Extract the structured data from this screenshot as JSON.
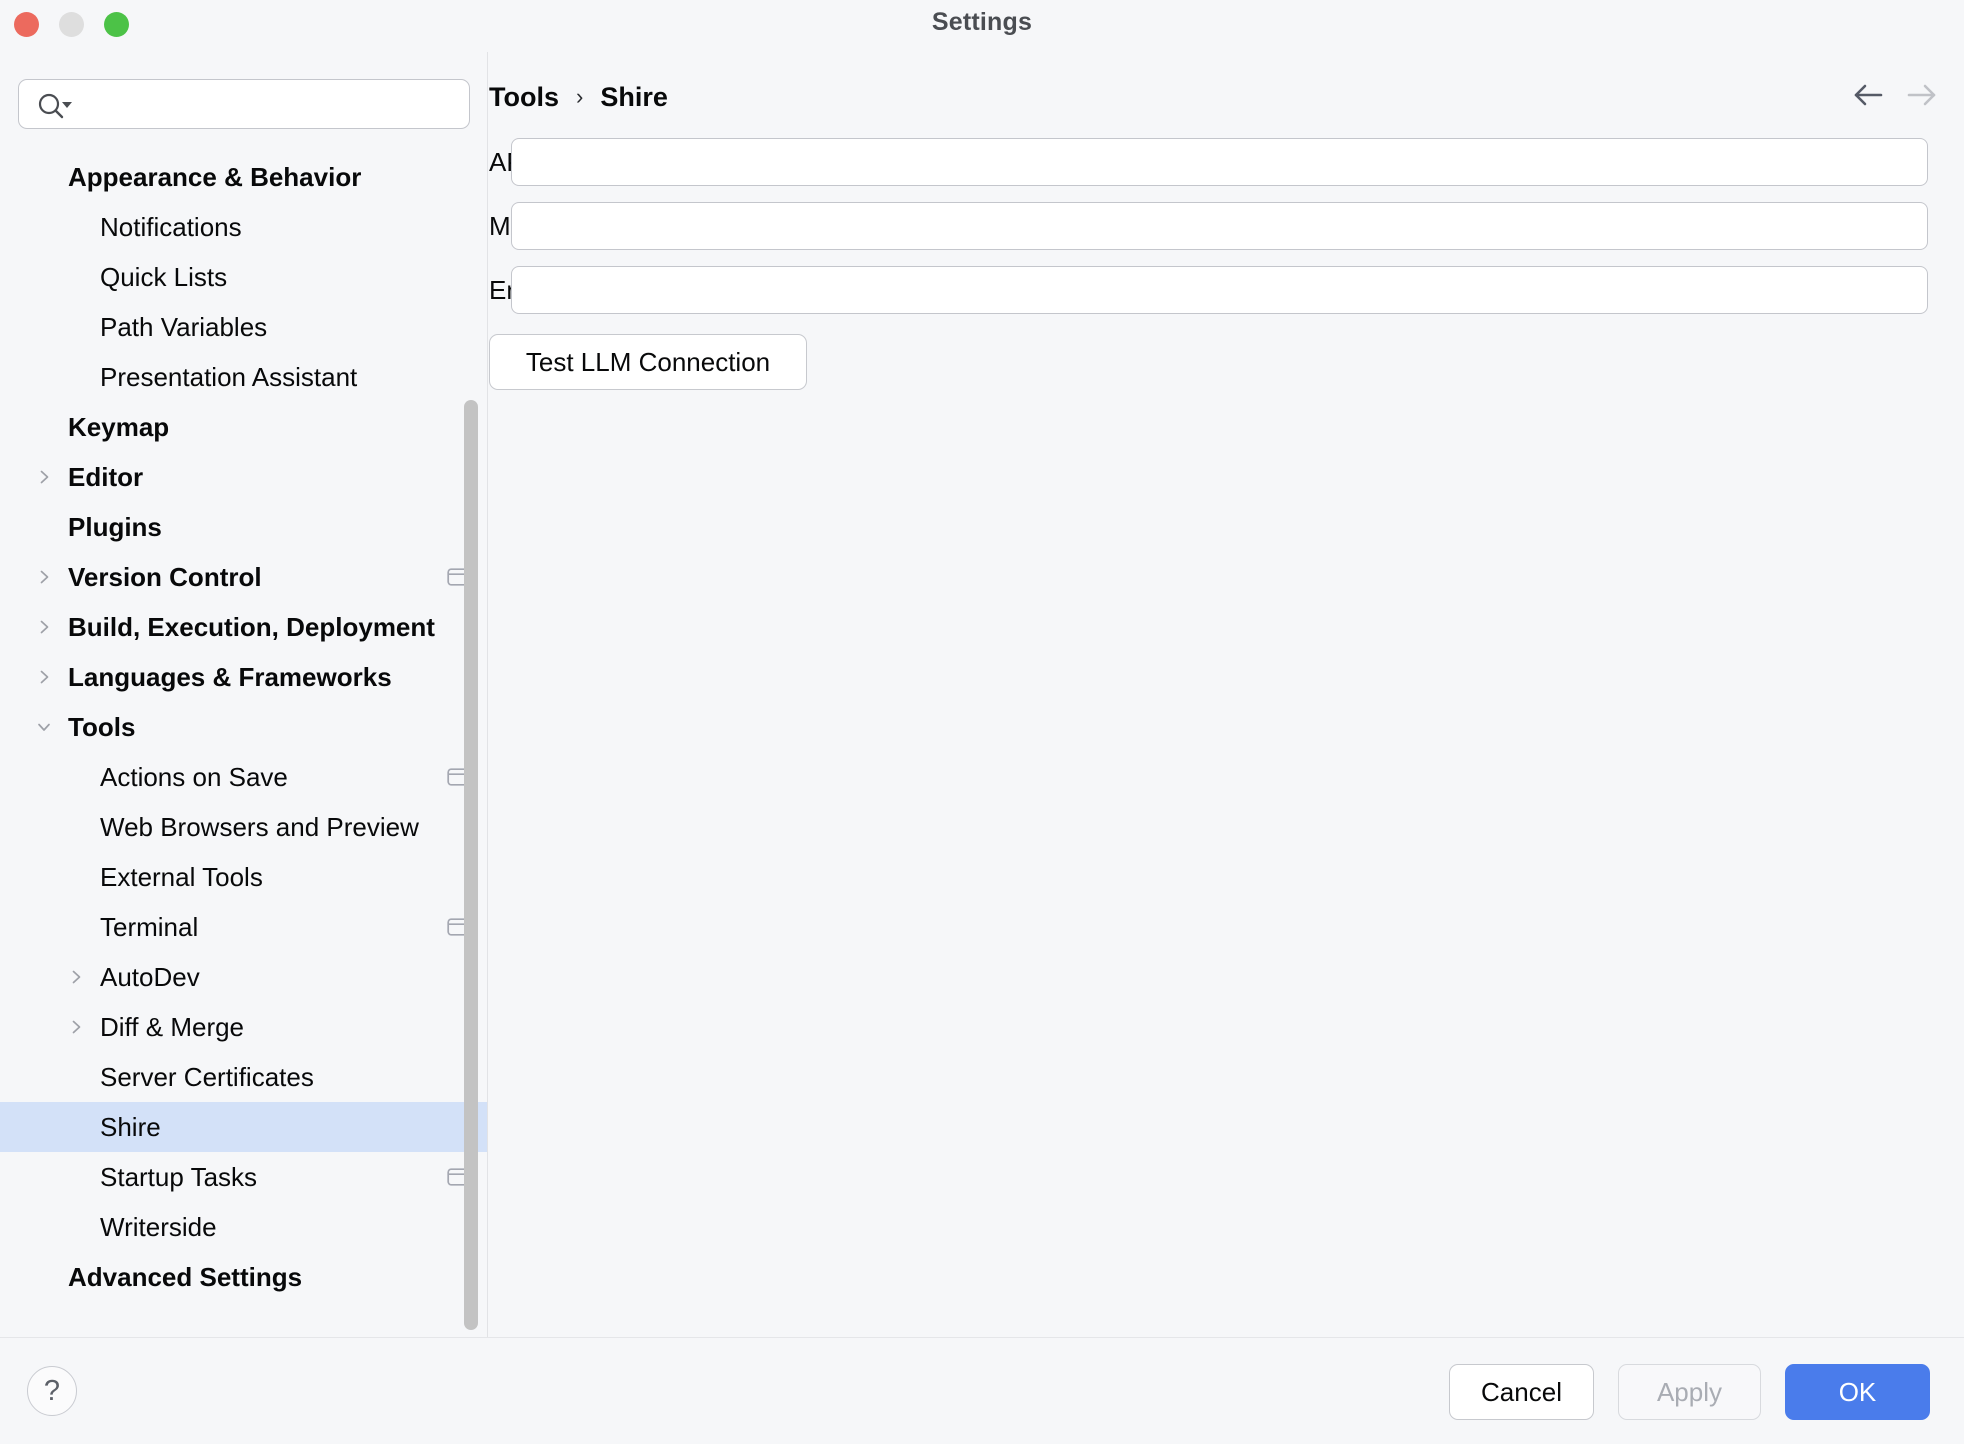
{
  "window": {
    "title": "Settings",
    "traffic_lights": [
      "close-button",
      "minimize-button",
      "zoom-button"
    ],
    "colors": {
      "close": "#ec6a5e",
      "minimize": "#dedede",
      "zoom": "#4cc247",
      "background": "#f6f7f9",
      "selection": "#d3e1f8",
      "primary": "#4a7ceb"
    }
  },
  "search": {
    "value": "",
    "placeholder": "",
    "icon": "search-icon"
  },
  "sidebar": {
    "items": [
      {
        "label": "Appearance & Behavior",
        "level": 0,
        "chevron": "none",
        "icon": null,
        "selected": false
      },
      {
        "label": "Notifications",
        "level": 1,
        "chevron": "none",
        "icon": null,
        "selected": false
      },
      {
        "label": "Quick Lists",
        "level": 1,
        "chevron": "none",
        "icon": null,
        "selected": false
      },
      {
        "label": "Path Variables",
        "level": 1,
        "chevron": "none",
        "icon": null,
        "selected": false
      },
      {
        "label": "Presentation Assistant",
        "level": 1,
        "chevron": "none",
        "icon": null,
        "selected": false
      },
      {
        "label": "Keymap",
        "level": 0,
        "chevron": "none",
        "icon": null,
        "selected": false
      },
      {
        "label": "Editor",
        "level": 0,
        "chevron": "collapsed",
        "icon": null,
        "selected": false
      },
      {
        "label": "Plugins",
        "level": 0,
        "chevron": "none",
        "icon": null,
        "selected": false
      },
      {
        "label": "Version Control",
        "level": 0,
        "chevron": "collapsed",
        "icon": "window-icon",
        "selected": false
      },
      {
        "label": "Build, Execution, Deployment",
        "level": 0,
        "chevron": "collapsed",
        "icon": null,
        "selected": false
      },
      {
        "label": "Languages & Frameworks",
        "level": 0,
        "chevron": "collapsed",
        "icon": null,
        "selected": false
      },
      {
        "label": "Tools",
        "level": 0,
        "chevron": "expanded",
        "icon": null,
        "selected": false
      },
      {
        "label": "Actions on Save",
        "level": 1,
        "chevron": "none",
        "icon": "window-icon",
        "selected": false
      },
      {
        "label": "Web Browsers and Preview",
        "level": 1,
        "chevron": "none",
        "icon": null,
        "selected": false
      },
      {
        "label": "External Tools",
        "level": 1,
        "chevron": "none",
        "icon": null,
        "selected": false
      },
      {
        "label": "Terminal",
        "level": 1,
        "chevron": "none",
        "icon": "window-icon",
        "selected": false
      },
      {
        "label": "AutoDev",
        "level": 1,
        "chevron": "collapsed",
        "icon": null,
        "selected": false
      },
      {
        "label": "Diff & Merge",
        "level": 1,
        "chevron": "collapsed",
        "icon": null,
        "selected": false
      },
      {
        "label": "Server Certificates",
        "level": 1,
        "chevron": "none",
        "icon": null,
        "selected": false
      },
      {
        "label": "Shire",
        "level": 1,
        "chevron": "none",
        "icon": null,
        "selected": true
      },
      {
        "label": "Startup Tasks",
        "level": 1,
        "chevron": "none",
        "icon": "window-icon",
        "selected": false
      },
      {
        "label": "Writerside",
        "level": 1,
        "chevron": "none",
        "icon": null,
        "selected": false
      },
      {
        "label": "Advanced Settings",
        "level": 0,
        "chevron": "none",
        "icon": null,
        "selected": false
      }
    ]
  },
  "main": {
    "breadcrumb": {
      "parent": "Tools",
      "separator": "›",
      "current": "Shire"
    },
    "nav": {
      "back": "back-arrow-icon",
      "forward": "forward-arrow-icon"
    },
    "fields": [
      {
        "label": "API Host:",
        "value": "",
        "placeholder": ""
      },
      {
        "label": "Model Name:",
        "value": "",
        "placeholder": ""
      },
      {
        "label": "Engine Token:",
        "value": "",
        "placeholder": ""
      }
    ],
    "test_button": "Test LLM Connection"
  },
  "footer": {
    "help": "?",
    "cancel": "Cancel",
    "apply": "Apply",
    "ok": "OK"
  }
}
